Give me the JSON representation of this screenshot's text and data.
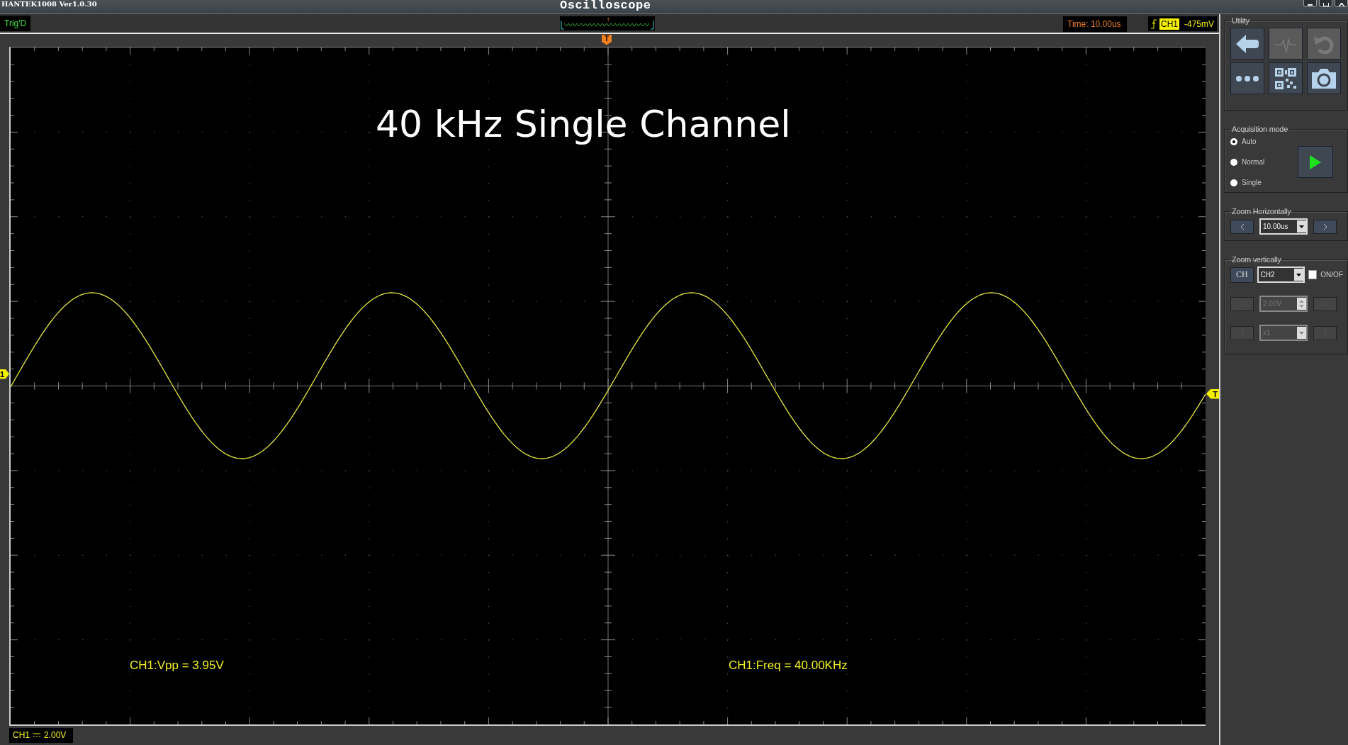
{
  "window": {
    "app_version": "HANTEK1008 Ver1.0.30",
    "title": "Oscilloscope"
  },
  "toolbar": {
    "trigger_status": "Trig'D",
    "preview_marker": "T",
    "time_base": "Time: 10.00us",
    "trigger_channel": "CH1",
    "trigger_level": "-475mV"
  },
  "screen": {
    "trigger_position_marker": "T",
    "channel_marker": "1",
    "trigger_level_marker": "T",
    "annotation": "40 kHz Single Channel",
    "measurements": [
      "CH1:Vpp = 3.95V",
      "CH1:Freq = 40.00KHz"
    ]
  },
  "channel_scale": {
    "channel": "CH1",
    "volts_per_div": "2.00V"
  },
  "utility": {
    "title": "Utility",
    "buttons": [
      {
        "kind": "back",
        "disabled": false
      },
      {
        "kind": "pulse",
        "disabled": true
      },
      {
        "kind": "undo",
        "disabled": true
      },
      {
        "kind": "more",
        "disabled": false
      },
      {
        "kind": "qr",
        "disabled": false
      },
      {
        "kind": "camera",
        "disabled": false
      }
    ]
  },
  "acquisition": {
    "title": "Acquisition mode",
    "modes": [
      {
        "label": "Auto",
        "selected": true
      },
      {
        "label": "Normal",
        "selected": false
      },
      {
        "label": "Single",
        "selected": false
      }
    ]
  },
  "zoom_horizontal": {
    "title": "Zoom Horizontally",
    "value": "10.00us"
  },
  "zoom_vertical": {
    "title": "Zoom vertically",
    "channel_button": "CH",
    "channel": "CH2",
    "toggle": {
      "label": "ON/OF",
      "checked": false
    },
    "rows": [
      {
        "kind": "spin",
        "value": "2.00V",
        "disabled": true
      },
      {
        "kind": "select",
        "value": "x1",
        "disabled": true
      }
    ]
  }
}
